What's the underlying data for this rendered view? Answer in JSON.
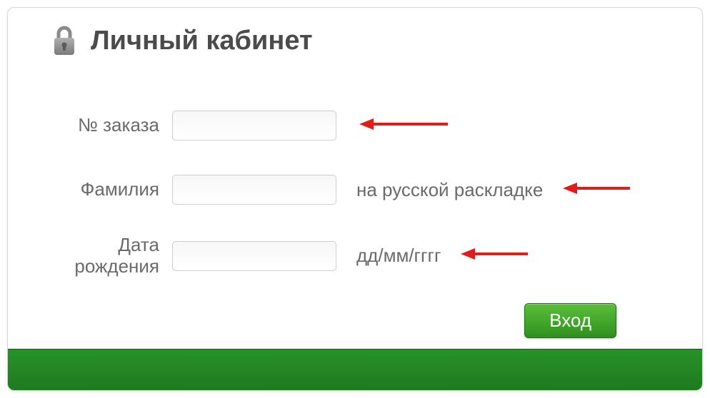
{
  "title": "Личный кабинет",
  "fields": {
    "order": {
      "label": "№ заказа",
      "value": ""
    },
    "surname": {
      "label": "Фамилия",
      "value": "",
      "hint": "на русской раскладке"
    },
    "birthdate": {
      "label": "Дата рождения",
      "value": "",
      "hint": "дд/мм/гггг"
    }
  },
  "button": {
    "login": "Вход"
  },
  "colors": {
    "accent": "#2f8f1f",
    "arrow": "#e21b1b"
  }
}
